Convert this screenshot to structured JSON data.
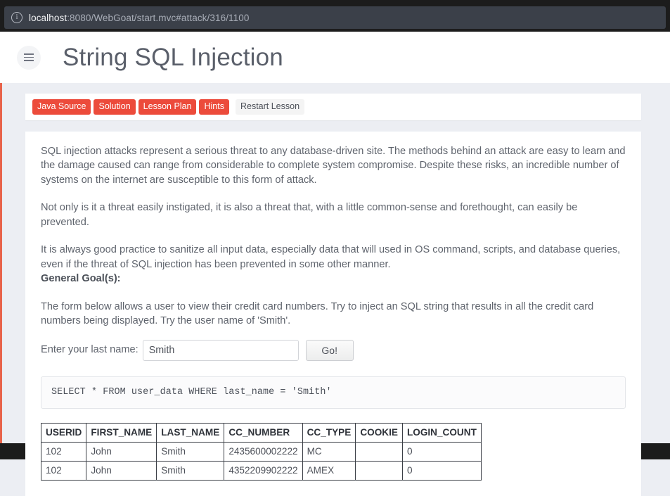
{
  "browser": {
    "info_icon": "info-circle-icon",
    "url_host": "localhost",
    "url_rest": ":8080/WebGoat/start.mvc#attack/316/1100"
  },
  "header": {
    "menu_icon": "hamburger-menu-icon",
    "title": "String SQL Injection"
  },
  "toolbar": {
    "buttons": [
      {
        "label": "Java Source",
        "style": "red"
      },
      {
        "label": "Solution",
        "style": "red"
      },
      {
        "label": "Lesson Plan",
        "style": "red"
      },
      {
        "label": "Hints",
        "style": "red"
      },
      {
        "label": "Restart Lesson",
        "style": "plain"
      }
    ]
  },
  "lesson": {
    "paragraph1": "SQL injection attacks represent a serious threat to any database-driven site. The methods behind an attack are easy to learn and the damage caused can range from considerable to complete system compromise. Despite these risks, an incredible number of systems on the internet are susceptible to this form of attack.",
    "paragraph2": "Not only is it a threat easily instigated, it is also a threat that, with a little common-sense and forethought, can easily be prevented.",
    "paragraph3": "It is always good practice to sanitize all input data, especially data that will used in OS command, scripts, and database queries, even if the threat of SQL injection has been prevented in some other manner.",
    "goal_label": "General Goal(s):",
    "goal_text": "The form below allows a user to view their credit card numbers. Try to inject an SQL string that results in all the credit card numbers being displayed. Try the user name of 'Smith'."
  },
  "form": {
    "label": "Enter your last name:",
    "input_value": "Smith",
    "input_placeholder": "",
    "submit_label": "Go!"
  },
  "query": {
    "sql": "SELECT * FROM user_data WHERE last_name = 'Smith'"
  },
  "results": {
    "columns": [
      "USERID",
      "FIRST_NAME",
      "LAST_NAME",
      "CC_NUMBER",
      "CC_TYPE",
      "COOKIE",
      "LOGIN_COUNT"
    ],
    "rows": [
      [
        "102",
        "John",
        "Smith",
        "2435600002222",
        "MC",
        "",
        "0"
      ],
      [
        "102",
        "John",
        "Smith",
        "4352209902222",
        "AMEX",
        "",
        "0"
      ]
    ]
  },
  "colors": {
    "accent_red": "#ec4b3b",
    "left_border": "#e8634a",
    "chrome_dark": "#1c1c1c",
    "page_bg": "#eceef3",
    "panel_bg": "#ffffff",
    "text": "#5f646d"
  }
}
